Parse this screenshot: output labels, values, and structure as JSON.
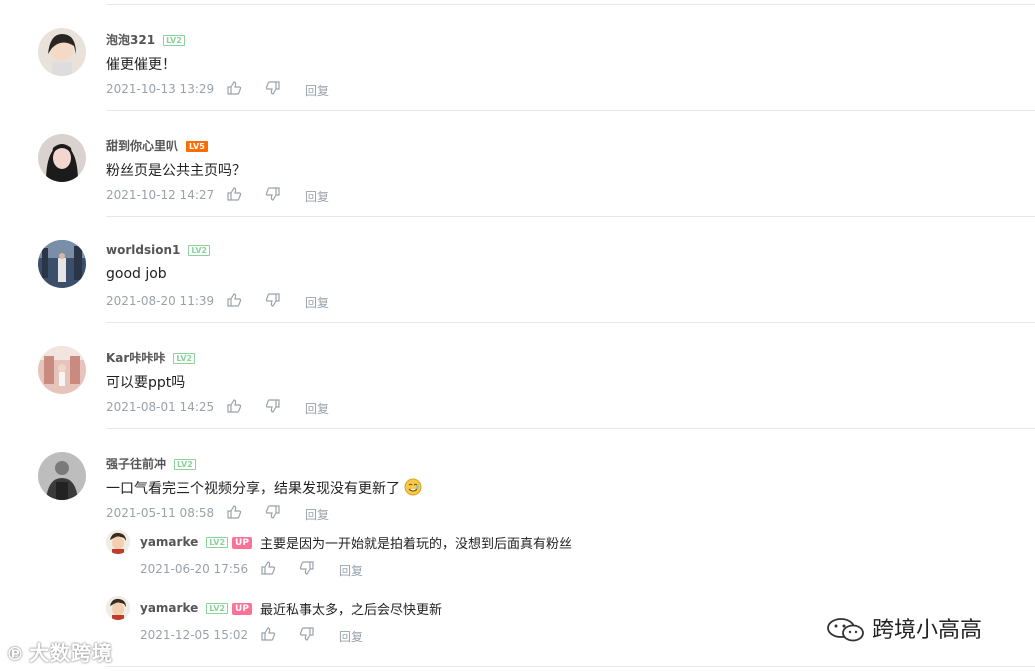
{
  "comments": [
    {
      "user": "泡泡321",
      "level": "LV2",
      "text": "催更催更！",
      "time": "2021-10-13 13:29",
      "reply": "回复"
    },
    {
      "user": "甜到你心里叭",
      "level": "LV5",
      "text": "粉丝页是公共主页吗？",
      "time": "2021-10-12 14:27",
      "reply": "回复"
    },
    {
      "user": "worldsion1",
      "level": "LV2",
      "text": "good job",
      "time": "2021-08-20 11:39",
      "reply": "回复"
    },
    {
      "user": "Kar咔咔咔",
      "level": "LV2",
      "text": "可以要ppt吗",
      "time": "2021-08-01 14:25",
      "reply": "回复"
    },
    {
      "user": "强子往前冲",
      "level": "LV2",
      "text": "一口气看完三个视频分享，结果发现没有更新了",
      "time": "2021-05-11 08:58",
      "reply": "回复"
    }
  ],
  "replies": [
    {
      "user": "yamarke",
      "level": "LV2",
      "badge": "UP",
      "text": "主要是因为一开始就是拍着玩的，没想到后面真有粉丝",
      "time": "2021-06-20 17:56",
      "reply": "回复"
    },
    {
      "user": "yamarke",
      "level": "LV2",
      "badge": "UP",
      "text": "最近私事太多，之后会尽快更新",
      "time": "2021-12-05 15:02",
      "reply": "回复"
    }
  ],
  "watermarks": {
    "left": "大数跨境",
    "right": "跨境小高高"
  },
  "colors": {
    "accent_pink": "#fb7299",
    "level_green": "#8bd29b",
    "level_orange": "#ff6c00",
    "meta_gray": "#99a2aa"
  }
}
